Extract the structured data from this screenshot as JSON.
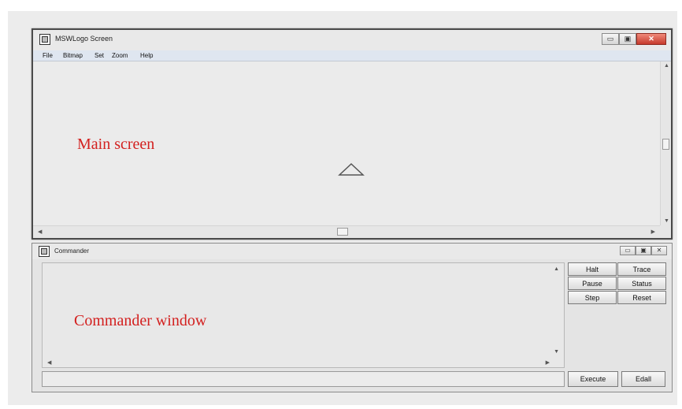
{
  "main_window": {
    "title": "MSWLogo Screen",
    "menu": [
      "File",
      "Bitmap",
      "Set",
      "Zoom",
      "Help"
    ],
    "controls": {
      "minimize": "▭",
      "maximize": "▣",
      "close": "✕"
    },
    "annotation": "Main screen",
    "turtle_icon": "turtle-triangle-icon"
  },
  "commander": {
    "title": "Commander",
    "buttons": [
      "Halt",
      "Trace",
      "Pause",
      "Status",
      "Step",
      "Reset"
    ],
    "execute_label": "Execute",
    "edall_label": "Edall",
    "annotation": "Commander window",
    "input_value": ""
  },
  "colors": {
    "annotation": "#d3201f",
    "close_button": "#c63a2c"
  }
}
